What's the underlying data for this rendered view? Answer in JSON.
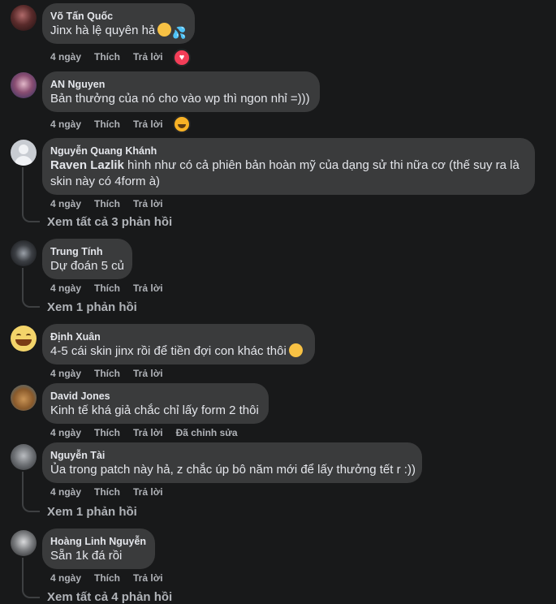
{
  "comments": [
    {
      "author": "Võ Tấn Quốc",
      "text": "Jinx hà lệ quyên hả",
      "time": "4 ngày",
      "like": "Thích",
      "reply": "Trả lời"
    },
    {
      "author": "AN Nguyen",
      "text": "Bản thưởng của nó cho vào wp thì ngon nhỉ =)))",
      "time": "4 ngày",
      "like": "Thích",
      "reply": "Trả lời"
    },
    {
      "author": "Nguyễn Quang Khánh",
      "mention": "Raven Lazlik",
      "text": " hình như có cả phiên bản hoàn mỹ của dạng sử thi nữa cơ (thế suy ra là skin này có 4form à)",
      "time": "4 ngày",
      "like": "Thích",
      "reply": "Trả lời",
      "replies": "Xem tất cả 3 phản hồi"
    },
    {
      "author": "Trung Tính",
      "text": "Dự đoán 5 củ",
      "time": "4 ngày",
      "like": "Thích",
      "reply": "Trả lời",
      "replies": "Xem 1 phản hồi"
    },
    {
      "author": "Định Xuân",
      "text": "4-5 cái skin jinx rồi để tiền đợi con khác thôi",
      "time": "4 ngày",
      "like": "Thích",
      "reply": "Trả lời"
    },
    {
      "author": "David Jones",
      "text": "Kinh tế khá giả chắc chỉ lấy form 2 thôi",
      "time": "4 ngày",
      "like": "Thích",
      "reply": "Trả lời",
      "edited": "Đã chỉnh sửa"
    },
    {
      "author": "Nguyễn Tài",
      "text": "Ủa trong patch này hả, z chắc úp bô năm mới để lấy thưởng tết r :))",
      "time": "4 ngày",
      "like": "Thích",
      "reply": "Trả lời",
      "replies": "Xem 1 phản hồi"
    },
    {
      "author": "Hoàng Linh Nguyễn",
      "text": "Sẵn 1k đá rồi",
      "time": "4 ngày",
      "like": "Thích",
      "reply": "Trả lời",
      "replies": "Xem tất cả 4 phản hồi"
    }
  ],
  "colors": {
    "background": "#18191a",
    "bubble": "#3a3b3c",
    "text": "#e4e6eb",
    "muted": "#b0b3b8",
    "love": "#f33e58",
    "haha": "#f7b125"
  },
  "icons": {
    "love": "heart-reaction-icon",
    "haha": "haha-reaction-icon"
  }
}
